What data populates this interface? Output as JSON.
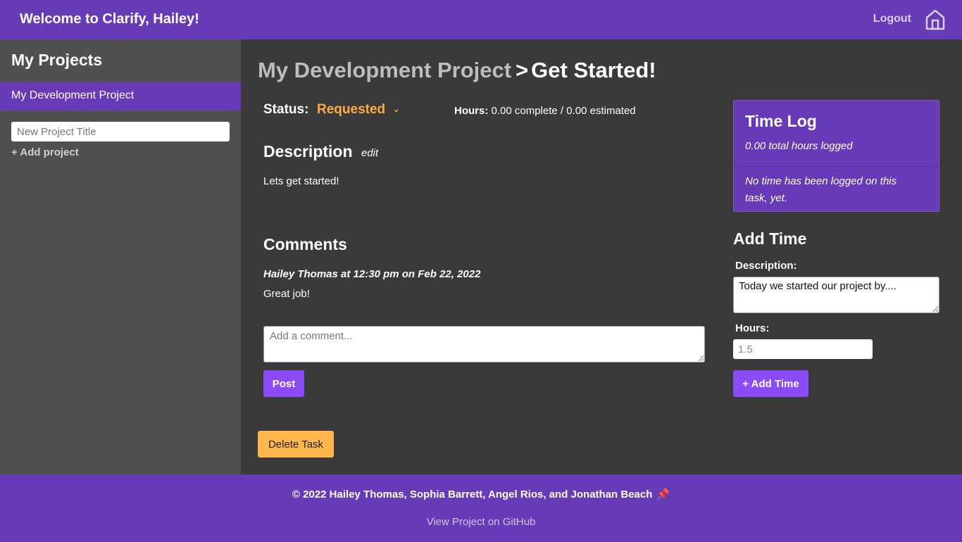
{
  "header": {
    "welcome": "Welcome to Clarify, Hailey!",
    "logout": "Logout",
    "home_icon": "home-icon"
  },
  "sidebar": {
    "title": "My Projects",
    "projects": [
      {
        "label": "My Development Project"
      }
    ],
    "new_project_placeholder": "New Project Title",
    "add_project": "+ Add project"
  },
  "task": {
    "breadcrumb_project": "My Development Project",
    "breadcrumb_sep": ">",
    "title": "Get Started!",
    "status_label": "Status:",
    "status_value": "Requested",
    "hours_label": "Hours:",
    "hours_value": "0.00 complete / 0.00 estimated",
    "description_heading": "Description",
    "edit_label": "edit",
    "description_text": "Lets get started!",
    "comments_heading": "Comments",
    "comments": [
      {
        "meta": "Hailey Thomas at 12:30 pm on Feb 22, 2022",
        "body": "Great job!"
      }
    ],
    "comment_placeholder": "Add a comment...",
    "post_label": "Post",
    "delete_label": "Delete Task"
  },
  "time_log": {
    "title": "Time Log",
    "total": "0.00 total hours logged",
    "empty": "No time has been logged on this task, yet."
  },
  "add_time": {
    "heading": "Add Time",
    "description_label": "Description:",
    "description_value": "Today we started our project by....",
    "hours_label": "Hours:",
    "hours_placeholder": "1.5",
    "button_label": "+ Add Time"
  },
  "footer": {
    "copyright": "© 2022 Hailey Thomas, Sophia Barrett, Angel Rios, and Jonathan Beach",
    "pin_icon": "📌",
    "github_link": "View Project on GitHub"
  },
  "colors": {
    "brand_purple": "#673ab7",
    "button_purple": "#8b4cf7",
    "status_orange": "#ffad42",
    "delete_orange": "#ffb74d"
  }
}
